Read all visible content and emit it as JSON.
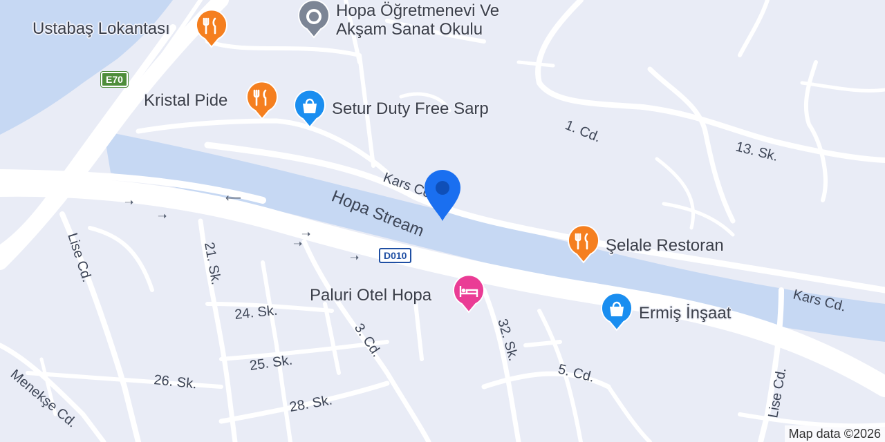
{
  "map": {
    "attribution": "Map data ©2026",
    "colors": {
      "land": "#e9ecf6",
      "water": "#c6d8f3",
      "road": "#ffffff",
      "label": "#3d4556",
      "food_pin": "#f57f1f",
      "shop_pin": "#1a8ef0",
      "hotel_pin": "#ea3c95",
      "gray_pin": "#7c8595",
      "location_pin": "#1a6ff0"
    },
    "water_labels": {
      "hopa_stream": "Hopa Stream"
    },
    "road_labels": {
      "kars_cd_1": "Kars Cd.",
      "kars_cd_2": "Kars Cd.",
      "cd_1": "1. Cd.",
      "sk_13": "13. Sk.",
      "lise_cd_1": "Lise Cd.",
      "lise_cd_2": "Lise Cd.",
      "sk_21": "21. Sk.",
      "sk_24": "24. Sk.",
      "sk_25": "25. Sk.",
      "sk_26": "26. Sk.",
      "sk_28": "28. Sk.",
      "cd_3": "3. Cd.",
      "sk_32": "32. Sk.",
      "cd_5": "5. Cd.",
      "menekse_cd": "Menekşe Cd."
    },
    "shields": {
      "e70": "E70",
      "d010": "D010"
    },
    "pois": {
      "ustabas": {
        "label": "Ustabaş Lokantası",
        "icon": "restaurant-icon"
      },
      "ogretmenevi": {
        "label_line1": "Hopa Öğretmenevi Ve",
        "label_line2": "Akşam Sanat Okulu",
        "icon": "school-icon"
      },
      "kristal": {
        "label": "Kristal Pide",
        "icon": "restaurant-icon"
      },
      "setur": {
        "label": "Setur Duty Free Sarp",
        "icon": "shopping-bag-icon"
      },
      "selale": {
        "label": "Şelale Restoran",
        "icon": "restaurant-icon"
      },
      "paluri": {
        "label": "Paluri Otel Hopa",
        "icon": "hotel-bed-icon"
      },
      "ermis": {
        "label": "Ermiş İnşaat",
        "icon": "shopping-bag-icon"
      }
    },
    "location_marker": {
      "icon": "location-pin-icon"
    }
  }
}
